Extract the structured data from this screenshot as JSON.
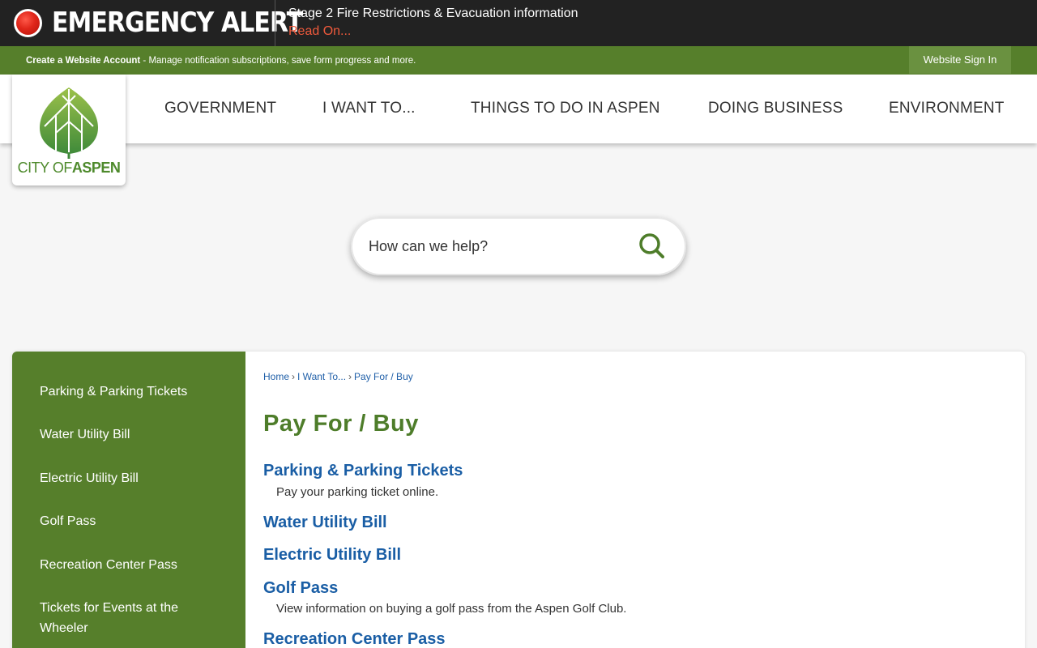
{
  "alert": {
    "title": "EMERGENCY ALERT",
    "message": "Stage 2 Fire Restrictions & Evacuation information",
    "link": "Read On..."
  },
  "account_bar": {
    "create_link": "Create a Website Account",
    "description": " - Manage notification subscriptions, save form progress and more.",
    "sign_in": "Website Sign In"
  },
  "logo": {
    "text_prefix": "CITY OF",
    "text_name": "ASPEN"
  },
  "nav": {
    "items": [
      "GOVERNMENT",
      "I WANT TO...",
      "THINGS TO DO IN ASPEN",
      "DOING BUSINESS",
      "ENVIRONMENT"
    ]
  },
  "search": {
    "placeholder": "How can we help?",
    "icon": "search-icon"
  },
  "sidebar": {
    "items": [
      "Parking & Parking Tickets",
      "Water Utility Bill",
      "Electric Utility Bill",
      "Golf Pass",
      "Recreation Center Pass",
      "Tickets for Events at the Wheeler"
    ]
  },
  "breadcrumb": {
    "items": [
      "Home",
      "I Want To...",
      "Pay For / Buy"
    ]
  },
  "main": {
    "title": "Pay For / Buy",
    "entries": [
      {
        "title": "Parking & Parking Tickets",
        "desc": "Pay your parking ticket online."
      },
      {
        "title": "Water Utility Bill",
        "desc": ""
      },
      {
        "title": "Electric Utility Bill",
        "desc": ""
      },
      {
        "title": "Golf Pass",
        "desc": "View information on buying a golf pass from the Aspen Golf Club."
      },
      {
        "title": "Recreation Center Pass",
        "desc": ""
      }
    ]
  },
  "colors": {
    "alert_bg": "#222222",
    "alert_link": "#f05a3c",
    "brand_green": "#567f2b",
    "link_blue": "#1a5ea5",
    "title_green": "#4e7d2a"
  }
}
